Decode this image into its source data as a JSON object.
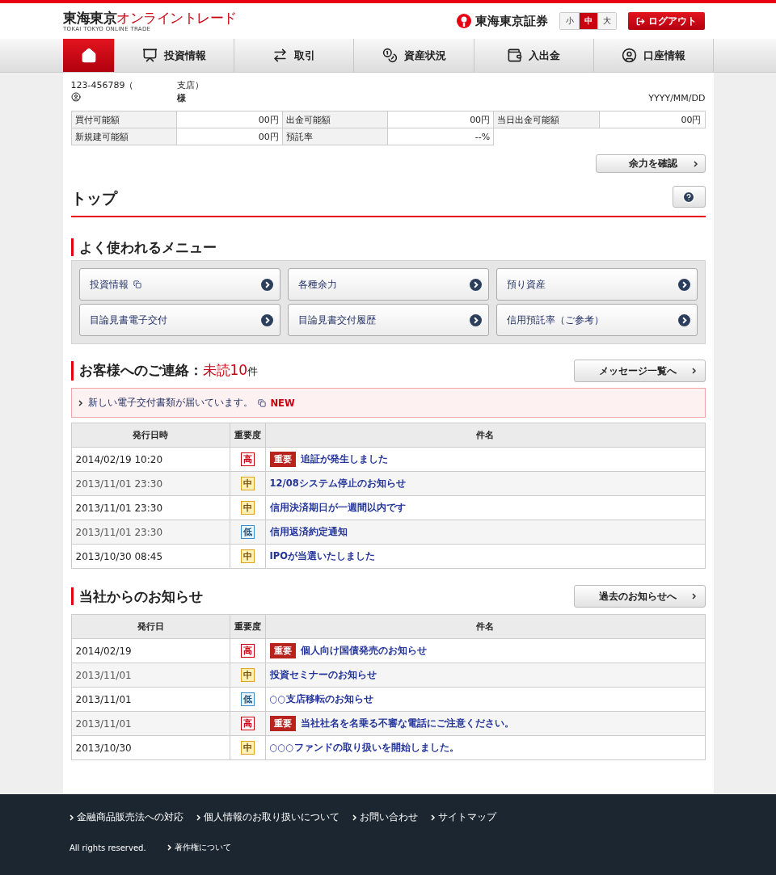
{
  "header": {
    "logo": "東海東京オンライントレード",
    "logo_sub": "TOKAI TOKYO ONLINE TRADE",
    "brand": "東海東京証券",
    "font_sizes": [
      {
        "label": "小",
        "selected": false
      },
      {
        "label": "中",
        "selected": true
      },
      {
        "label": "大",
        "selected": false
      }
    ],
    "logout": "ログアウト"
  },
  "nav": [
    {
      "kind": "home",
      "selected": true
    },
    {
      "kind": "info",
      "label": "投資情報",
      "selected": false
    },
    {
      "kind": "trade",
      "label": "取引",
      "selected": false
    },
    {
      "kind": "assets",
      "label": "資産状況",
      "selected": false
    },
    {
      "kind": "cash",
      "label": "入出金",
      "selected": false
    },
    {
      "kind": "account",
      "label": "口座情報",
      "selected": false
    }
  ],
  "account": {
    "number": "123-456789（",
    "branch": "支店）",
    "honorific": "様",
    "date": "YYYY/MM/DD"
  },
  "balances": [
    [
      {
        "label": "買付可能額",
        "value": "00円"
      },
      {
        "label": "出金可能額",
        "value": "00円"
      },
      {
        "label": "当日出金可能額",
        "value": "00円"
      }
    ],
    [
      {
        "label": "新規建可能額",
        "value": "00円"
      },
      {
        "label": "預託率",
        "value": "--%"
      }
    ]
  ],
  "check_button": "余力を確認",
  "page_title": "トップ",
  "frequent_menu": {
    "title": "よく使われるメニュー",
    "items": [
      {
        "label": "投資情報",
        "external": true
      },
      {
        "label": "各種余力",
        "external": false
      },
      {
        "label": "預り資産",
        "external": false
      },
      {
        "label": "目論見書電子交付",
        "external": false
      },
      {
        "label": "目論見書交付履歴",
        "external": false
      },
      {
        "label": "信用預託率（ご参考）",
        "external": false
      }
    ]
  },
  "messages": {
    "title": "お客様へのご連絡：",
    "unread_label": "未読",
    "unread_count": "10",
    "unit": "件",
    "button": "メッセージ一覧へ",
    "notice": {
      "text": "新しい電子交付書類が届いています。",
      "badge": "NEW"
    },
    "columns": [
      "発行日時",
      "重要度",
      "件名"
    ],
    "rows": [
      {
        "date": "2014/02/19 10:20",
        "priority": {
          "kind": "high",
          "label": "高"
        },
        "tag": "重要",
        "subject": "追証が発生しました"
      },
      {
        "date": "2013/11/01 23:30",
        "priority": {
          "kind": "mid",
          "label": "中"
        },
        "subject": "12/08システム停止のお知らせ"
      },
      {
        "date": "2013/11/01 23:30",
        "priority": {
          "kind": "mid",
          "label": "中"
        },
        "subject": "信用決済期日が一週間以内です"
      },
      {
        "date": "2013/11/01 23:30",
        "priority": {
          "kind": "low",
          "label": "低"
        },
        "subject": "信用返済約定通知"
      },
      {
        "date": "2013/10/30 08:45",
        "priority": {
          "kind": "mid",
          "label": "中"
        },
        "subject": "IPOが当選いたしました"
      }
    ]
  },
  "news": {
    "title": "当社からのお知らせ",
    "button": "過去のお知らせへ",
    "columns": [
      "発行日",
      "重要度",
      "件名"
    ],
    "rows": [
      {
        "date": "2014/02/19",
        "priority": {
          "kind": "high",
          "label": "高"
        },
        "tag": "重要",
        "subject": "個人向け国債発売のお知らせ"
      },
      {
        "date": "2013/11/01",
        "priority": {
          "kind": "mid",
          "label": "中"
        },
        "subject": "投資セミナーのお知らせ"
      },
      {
        "date": "2013/11/01",
        "priority": {
          "kind": "low",
          "label": "低"
        },
        "subject": "○○支店移転のお知らせ"
      },
      {
        "date": "2013/11/01",
        "priority": {
          "kind": "high",
          "label": "高"
        },
        "tag": "重要",
        "subject": "当社社名を名乗る不審な電話にご注意ください。"
      },
      {
        "date": "2013/10/30",
        "priority": {
          "kind": "mid",
          "label": "中"
        },
        "subject": "○○○ファンドの取り扱いを開始しました。"
      }
    ]
  },
  "footer": {
    "links": [
      "金融商品販売法への対応",
      "個人情報のお取り扱いについて",
      "お問い合わせ",
      "サイトマップ"
    ],
    "copyright": "All rights reserved.",
    "copyright_link": "著作権について"
  }
}
